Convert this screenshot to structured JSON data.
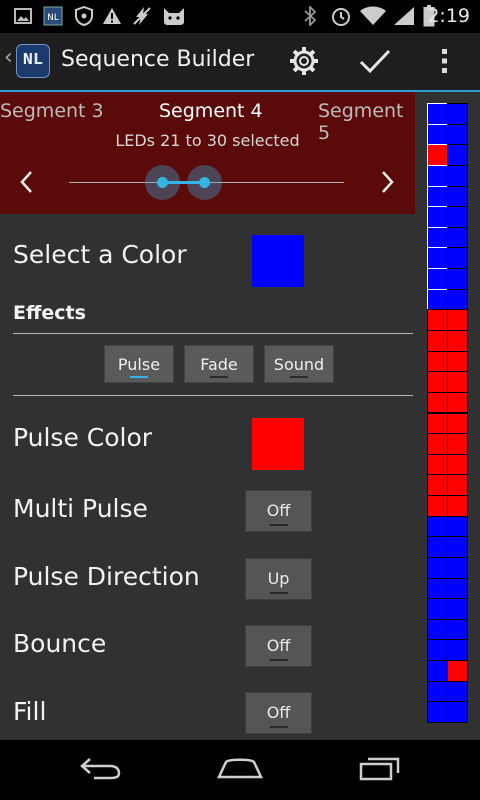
{
  "status_bar": {
    "time": "2:19",
    "left_icons": [
      "image-icon",
      "nl-app-icon",
      "shield-icon",
      "warning-icon",
      "flash-off-icon",
      "cat-icon"
    ],
    "right_icons": [
      "bluetooth-icon",
      "alarm-icon",
      "wifi-icon",
      "signal-icon",
      "battery-icon"
    ]
  },
  "action_bar": {
    "app_logo": "NL",
    "title": "Sequence Builder",
    "settings_icon": "gear-icon",
    "confirm_icon": "checkmark-icon",
    "overflow_icon": "overflow-menu-icon"
  },
  "segments": {
    "prev": "Segment 3",
    "current": "Segment 4",
    "next": "Segment 5",
    "range_text": "LEDs 21 to 30 selected"
  },
  "color_select": {
    "label": "Select a Color",
    "color": "#0000ff"
  },
  "effects": {
    "heading": "Effects",
    "buttons": [
      "Pulse",
      "Fade",
      "Sound"
    ],
    "active_index": 0
  },
  "pulse": {
    "color_label": "Pulse Color",
    "color": "#ff0000",
    "settings": [
      {
        "label": "Multi Pulse",
        "value": "Off"
      },
      {
        "label": "Pulse Direction",
        "value": "Up"
      },
      {
        "label": "Bounce",
        "value": "Off"
      },
      {
        "label": "Fill",
        "value": "Off"
      }
    ]
  },
  "colors": {
    "accent": "#33b5e5",
    "segment_bg": "#5b0a0a",
    "led_blue": "#0000ff",
    "led_red": "#ff0000"
  },
  "led_strip": {
    "columns": 2,
    "rows": [
      [
        "blue",
        "blue"
      ],
      [
        "blue",
        "blue"
      ],
      [
        "red",
        "blue"
      ],
      [
        "blue",
        "blue"
      ],
      [
        "blue",
        "blue"
      ],
      [
        "blue",
        "blue"
      ],
      [
        "blue",
        "blue"
      ],
      [
        "blue",
        "blue"
      ],
      [
        "blue",
        "blue"
      ],
      [
        "blue",
        "blue"
      ],
      [
        "red",
        "red"
      ],
      [
        "red",
        "red"
      ],
      [
        "red",
        "red"
      ],
      [
        "red",
        "red"
      ],
      [
        "red",
        "red"
      ],
      [
        "red",
        "red"
      ],
      [
        "red",
        "red"
      ],
      [
        "red",
        "red"
      ],
      [
        "red",
        "red"
      ],
      [
        "red",
        "red"
      ],
      [
        "blue",
        "blue"
      ],
      [
        "blue",
        "blue"
      ],
      [
        "blue",
        "blue"
      ],
      [
        "blue",
        "blue"
      ],
      [
        "blue",
        "blue"
      ],
      [
        "blue",
        "blue"
      ],
      [
        "blue",
        "blue"
      ],
      [
        "blue",
        "red"
      ],
      [
        "blue",
        "blue"
      ],
      [
        "blue",
        "blue"
      ]
    ],
    "outlined_rows": [
      0,
      9
    ]
  },
  "nav_bar": {
    "icons": [
      "back-icon",
      "home-icon",
      "recent-apps-icon"
    ]
  }
}
